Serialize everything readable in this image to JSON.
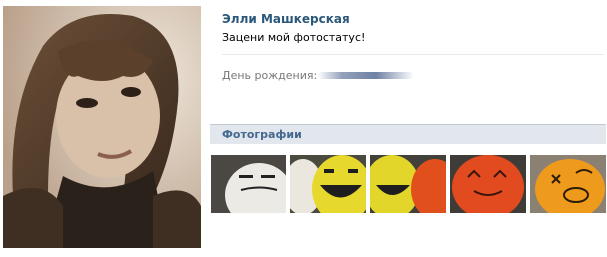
{
  "profile": {
    "name": "Элли Машкерская",
    "status": "Зацени мой фотостатус!"
  },
  "info": {
    "birthday_label": "День рождения:"
  },
  "photos": {
    "title": "Фотографии"
  },
  "colors": {
    "name_link": "#2b587a",
    "section_header_bg": "#e1e7ed",
    "section_header_text": "#45688e"
  }
}
